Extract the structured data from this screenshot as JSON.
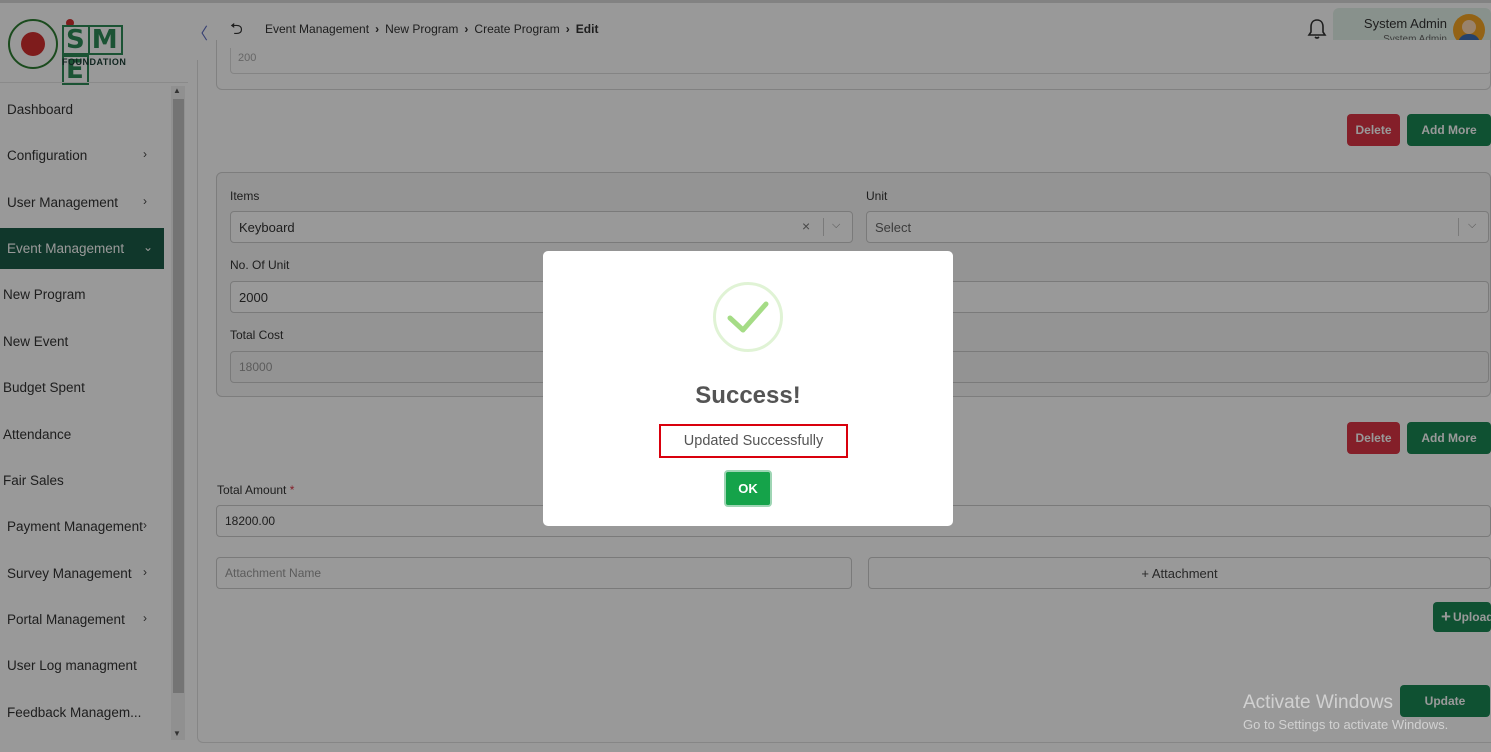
{
  "header": {
    "breadcrumb": [
      "Event Management",
      "New Program",
      "Create Program",
      "Edit"
    ],
    "user_name": "System Admin",
    "user_role": "System Admin"
  },
  "logo": {
    "sme": [
      "S",
      "M",
      "E"
    ],
    "foundation": "FOUNDATION"
  },
  "sidebar": {
    "items": [
      {
        "label": "Dashboard",
        "has_chevron": false
      },
      {
        "label": "Configuration",
        "has_chevron": true
      },
      {
        "label": "User Management",
        "has_chevron": true
      },
      {
        "label": "Event Management",
        "has_chevron": true,
        "active": true
      },
      {
        "label": "New Program",
        "sub": true
      },
      {
        "label": "New Event",
        "sub": true
      },
      {
        "label": "Budget Spent",
        "sub": true
      },
      {
        "label": "Attendance",
        "sub": true
      },
      {
        "label": "Fair Sales",
        "sub": true
      },
      {
        "label": "Payment Management",
        "has_chevron": true
      },
      {
        "label": "Survey Management",
        "has_chevron": true
      },
      {
        "label": "Portal Management",
        "has_chevron": true
      },
      {
        "label": "User Log managment",
        "has_chevron": false
      },
      {
        "label": "Feedback Managem...",
        "has_chevron": false
      }
    ]
  },
  "form": {
    "top_value": "200",
    "delete_label": "Delete",
    "add_more_label": "Add More",
    "items_label": "Items",
    "items_value": "Keyboard",
    "unit_label": "Unit",
    "unit_placeholder": "Select",
    "no_of_unit_label": "No. Of Unit",
    "no_of_unit_value": "2000",
    "total_cost_label": "Total Cost",
    "total_cost_value": "18000",
    "total_amount_label": "Total Amount",
    "total_amount_required": "*",
    "total_amount_value": "18200.00",
    "attachment_name_placeholder": "Attachment Name",
    "attachment_button": "+ Attachment",
    "upload_label": "Upload",
    "update_label": "Update"
  },
  "watermark": {
    "line1": "Activate Windows",
    "line2": "Go to Settings to activate Windows."
  },
  "modal": {
    "title": "Success!",
    "message": "Updated Successfully",
    "ok_label": "OK"
  },
  "colors": {
    "brand_green": "#1c5c48",
    "button_green": "#198754",
    "delete_red": "#dc3545",
    "highlight_red": "#d9000d"
  }
}
